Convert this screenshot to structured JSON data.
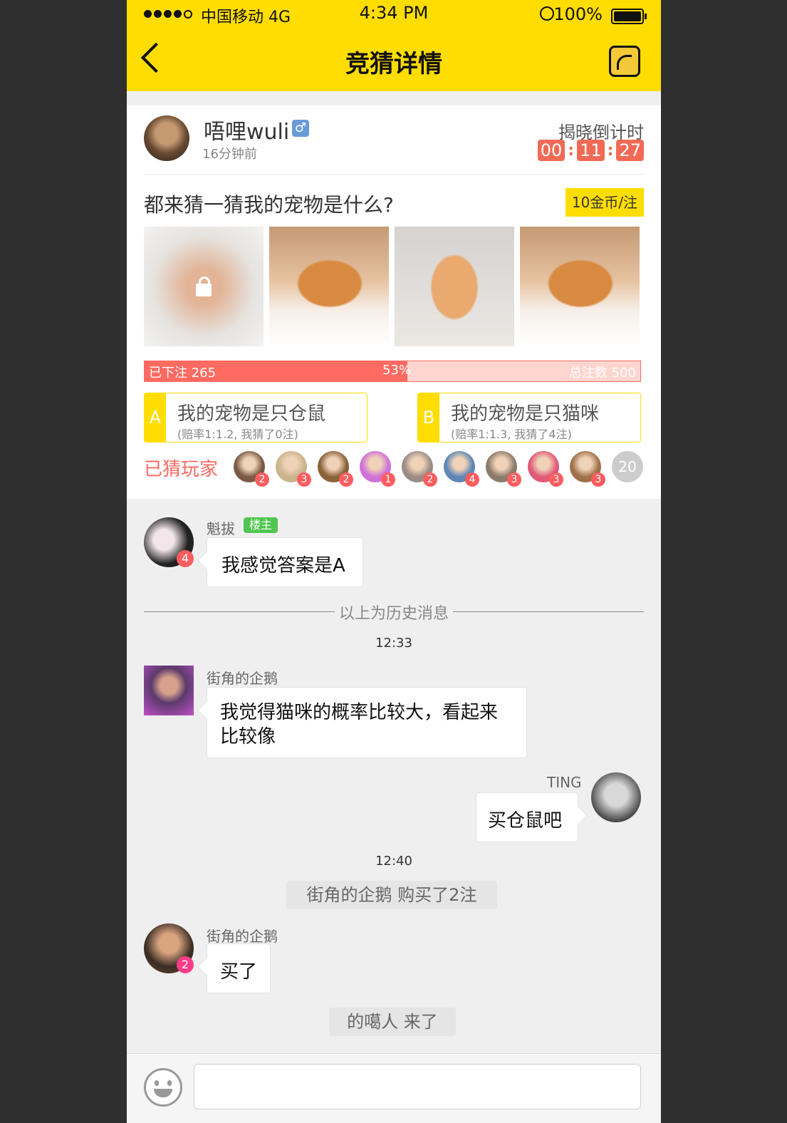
{
  "status_bar": {
    "carrier": "中国移动  4G",
    "time": "4:34 PM",
    "battery": "100%"
  },
  "nav": {
    "title": "竞猜详情"
  },
  "post": {
    "username": "唔哩wuli",
    "gender": "♂",
    "time_ago": "16分钟前",
    "countdown_label": "揭晓倒计时",
    "countdown": [
      "00",
      "11",
      "27"
    ],
    "question": "都来猜一猜我的宠物是什么?",
    "price": "10金币/注",
    "progress": {
      "left_label": "已下注 265",
      "percent_label": "53%",
      "percent": 53,
      "right_label": "总注数 500"
    },
    "options": [
      {
        "letter": "A",
        "title": "我的宠物是只仓鼠",
        "detail": "(赔率1:1.2, 我猜了0注)"
      },
      {
        "letter": "B",
        "title": "我的宠物是只猫咪",
        "detail": "(赔率1:1.3, 我猜了4注)"
      }
    ],
    "players_label": "已猜玩家",
    "players": [
      {
        "count": "2",
        "color": "#7a5a44"
      },
      {
        "count": "3",
        "color": "#c9b48c"
      },
      {
        "count": "2",
        "color": "#8a6238"
      },
      {
        "count": "1",
        "color": "#d070d8"
      },
      {
        "count": "2",
        "color": "#9a8c84"
      },
      {
        "count": "4",
        "color": "#5c86b6"
      },
      {
        "count": "3",
        "color": "#8c7a6a"
      },
      {
        "count": "3",
        "color": "#e05a78"
      },
      {
        "count": "3",
        "color": "#a07048"
      }
    ],
    "players_more": "20"
  },
  "chat": {
    "msg1": {
      "name": "魁拔",
      "tag": "楼主",
      "badge": "4",
      "text": "我感觉答案是A"
    },
    "history_label": "以上为历史消息",
    "time1": "12:33",
    "msg2": {
      "name": "街角的企鹅",
      "text_line1": "我觉得猫咪的概率比较大，看起来",
      "text_line2": "比较像"
    },
    "msg3": {
      "name": "TING",
      "text": "买仓鼠吧"
    },
    "time2": "12:40",
    "sys1": "街角的企鹅 购买了2注",
    "msg4": {
      "name": "街角的企鹅",
      "badge": "2",
      "text": "买了"
    },
    "sys2": "的噶人 来了"
  },
  "colors": {
    "accent": "#ffdd00",
    "progress": "#ff6a61",
    "badge": "#fe5d60",
    "tag": "#50c650"
  }
}
